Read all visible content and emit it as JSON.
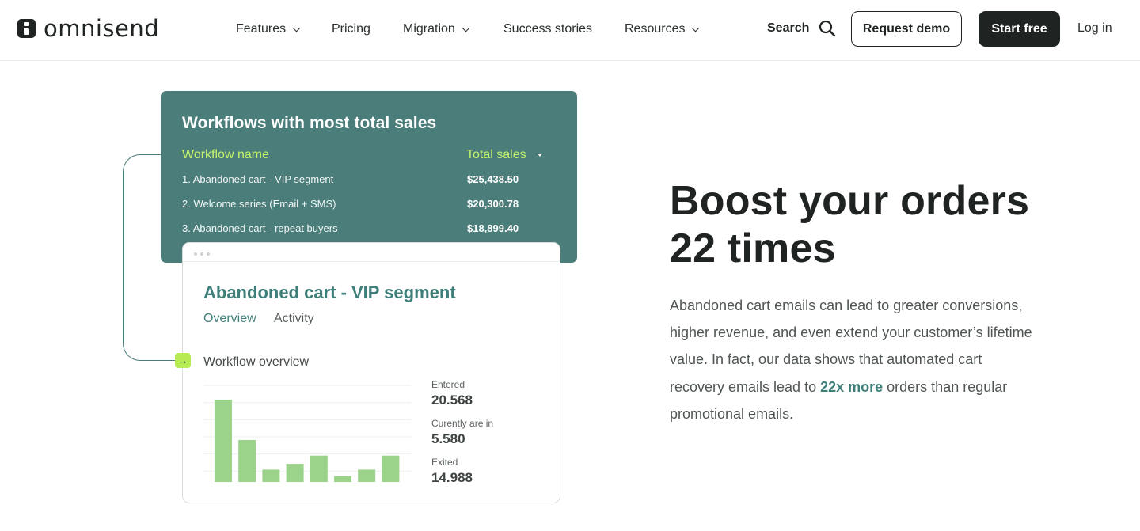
{
  "header": {
    "logo_text": "omnisend",
    "nav": [
      {
        "label": "Features",
        "has_dropdown": true
      },
      {
        "label": "Pricing",
        "has_dropdown": false
      },
      {
        "label": "Migration",
        "has_dropdown": true
      },
      {
        "label": "Success stories",
        "has_dropdown": false
      },
      {
        "label": "Resources",
        "has_dropdown": true
      }
    ],
    "search_label": "Search",
    "request_demo_label": "Request demo",
    "start_free_label": "Start free",
    "login_label": "Log in"
  },
  "sales_card": {
    "title": "Workflows with most total sales",
    "col_name": "Workflow name",
    "col_total": "Total sales",
    "rows": [
      {
        "name": "1. Abandoned cart - VIP segment",
        "value": "$25,438.50"
      },
      {
        "name": "2. Welcome series (Email + SMS)",
        "value": "$20,300.78"
      },
      {
        "name": "3. Abandoned cart - repeat buyers",
        "value": "$18,899.40"
      }
    ]
  },
  "detail_card": {
    "title": "Abandoned cart - VIP segment",
    "tab_overview": "Overview",
    "tab_activity": "Activity",
    "section_title": "Workflow overview",
    "stats": [
      {
        "label": "Entered",
        "value": "20.568"
      },
      {
        "label": "Curently are in",
        "value": "5.580"
      },
      {
        "label": "Exited",
        "value": "14.988"
      }
    ]
  },
  "chart_data": {
    "type": "bar",
    "values": [
      100,
      51,
      15,
      22,
      32,
      7,
      15,
      32
    ],
    "ylim": [
      0,
      125
    ],
    "grid": true,
    "bar_color": "#9bd38b"
  },
  "hero": {
    "headline_line1": "Boost your orders",
    "headline_line2": "22 times",
    "body_before": "Abandoned cart emails can lead to greater conversions, higher revenue, and even extend your customer’s lifetime value. In fact, our data shows that automated cart recovery emails lead to ",
    "body_highlight": "22x more",
    "body_after": " orders than regular promotional emails."
  },
  "colors": {
    "brand_dark": "#1f2322",
    "teal": "#4b7e7a",
    "lime": "#c6f36b",
    "accent_text": "#3f7f79"
  }
}
